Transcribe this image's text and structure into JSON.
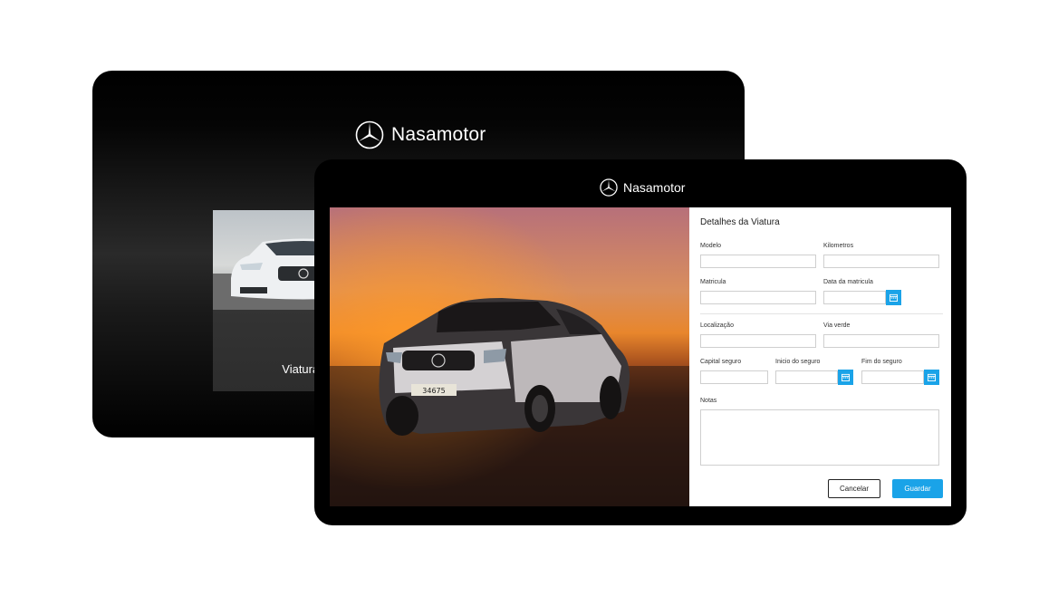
{
  "back_screen": {
    "brand": "Nasamotor",
    "card_label": "Viaturas"
  },
  "front_screen": {
    "brand": "Nasamotor",
    "plate_text": "34675",
    "form": {
      "title": "Detalhes da Viatura",
      "fields": {
        "modelo": "Modelo",
        "kilometros": "Kilometros",
        "matricula": "Matricula",
        "data_matricula": "Data da matricula",
        "localizacao": "Localização",
        "via_verde": "Via verde",
        "capital_seguro": "Capital seguro",
        "inicio_seguro": "Inicio do seguro",
        "fim_seguro": "Fim do seguro",
        "notas": "Notas"
      },
      "cancel_label": "Cancelar",
      "save_label": "Guardar"
    }
  },
  "colors": {
    "accent": "#1aa3e8",
    "frame": "#000000"
  },
  "icons": {
    "brand_logo": "three-pointed-star-logo",
    "date_picker": "calendar-icon"
  }
}
